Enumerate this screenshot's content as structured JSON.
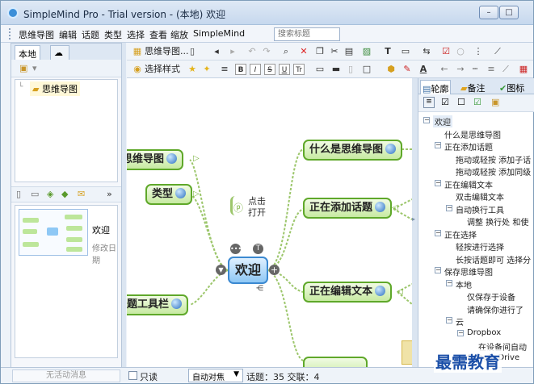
{
  "window": {
    "title": "SimpleMind Pro - Trial version - (本地) 欢迎",
    "minimize": "–",
    "maximize": "□",
    "close": "✕"
  },
  "menu": [
    "思维导图",
    "编辑",
    "话题",
    "类型",
    "选择",
    "查看",
    "缩放",
    "SimpleMind"
  ],
  "search": {
    "placeholder": "搜索标题"
  },
  "left_tabs": {
    "local": "本地"
  },
  "tree": {
    "item": "思维导图"
  },
  "thumbnail": {
    "title": "欢迎",
    "subtitle": "修改日期"
  },
  "toolbar": {
    "mindmap_label": "思维导图...",
    "style_label": "选择样式"
  },
  "mindmap": {
    "center": "欢迎",
    "left_nodes": [
      "思维导图",
      "类型",
      "话题工具栏"
    ],
    "right_nodes": [
      "什么是思维导图",
      "正在添加话题",
      "正在编辑文本"
    ],
    "hint_line1": "点击",
    "hint_line2": "打开",
    "left_partial": [
      "思维导图",
      "类型",
      "题工具栏"
    ]
  },
  "right_tabs": {
    "outline": "轮廓",
    "notes": "备注",
    "icons": "图标"
  },
  "outline": [
    {
      "text": "欢迎",
      "level": 0,
      "expander": "−"
    },
    {
      "text": "什么是思维导图",
      "level": 1,
      "expander": ""
    },
    {
      "text": "正在添加话题",
      "level": 1,
      "expander": "−"
    },
    {
      "text": "拖动或轻按 添加子话",
      "level": 2,
      "expander": ""
    },
    {
      "text": "拖动或轻按 添加同级",
      "level": 2,
      "expander": ""
    },
    {
      "text": "正在编辑文本",
      "level": 1,
      "expander": "−"
    },
    {
      "text": "双击编辑文本",
      "level": 2,
      "expander": ""
    },
    {
      "text": "自动换行工具",
      "level": 2,
      "expander": "−"
    },
    {
      "text": "调整 换行处 和使",
      "level": 3,
      "expander": ""
    },
    {
      "text": "正在选择",
      "level": 1,
      "expander": "−"
    },
    {
      "text": "轻按进行选择",
      "level": 2,
      "expander": ""
    },
    {
      "text": "长按话题即可 选择分",
      "level": 2,
      "expander": ""
    },
    {
      "text": "保存思维导图",
      "level": 1,
      "expander": "−"
    },
    {
      "text": "本地",
      "level": 2,
      "expander": "−"
    },
    {
      "text": "仅保存于设备",
      "level": 3,
      "expander": ""
    },
    {
      "text": "请确保你进行了",
      "level": 3,
      "expander": ""
    },
    {
      "text": "云",
      "level": 2,
      "expander": "−"
    },
    {
      "text": "Dropbox",
      "level": 3,
      "expander": "−"
    },
    {
      "text": "在设备间自动",
      "level": 4,
      "expander": ""
    },
    {
      "text": "Google Drive",
      "level": 3,
      "expander": "−"
    }
  ],
  "status": {
    "note": "无活动消息",
    "readonly": "只读",
    "focus": "自动对焦",
    "counts": "话题：35 交联：4"
  },
  "watermark": "最需教育"
}
